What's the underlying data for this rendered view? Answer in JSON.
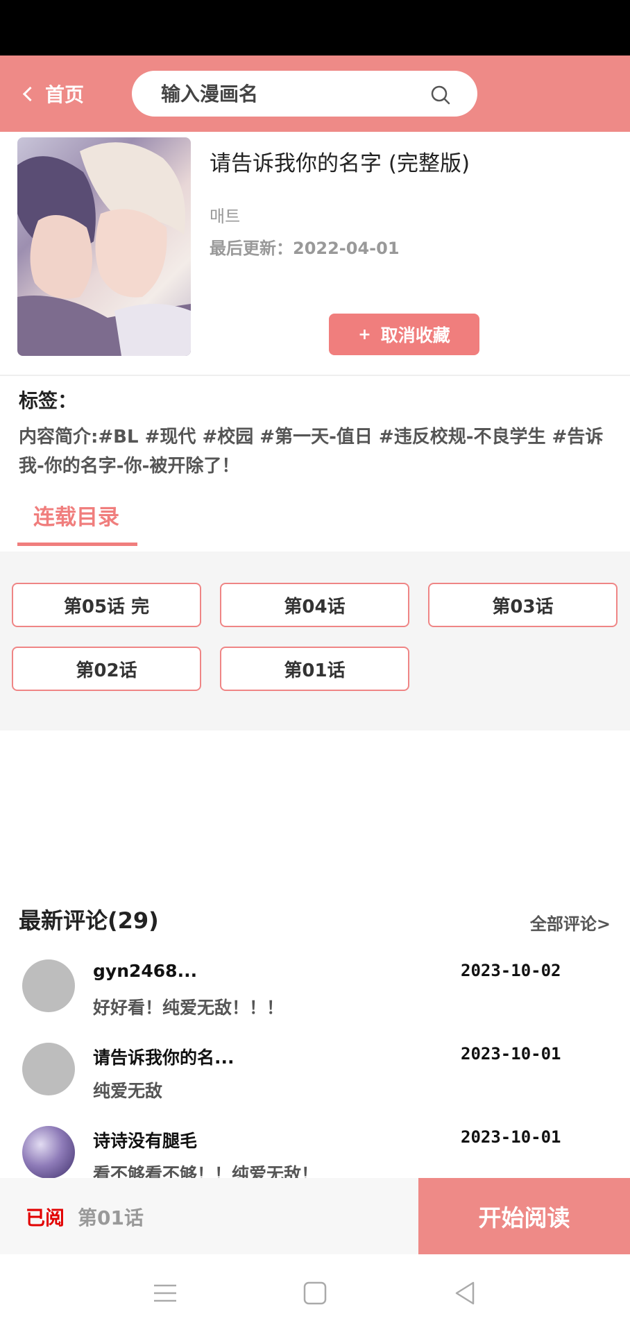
{
  "header": {
    "back_label": "首页",
    "search_placeholder": "输入漫画名"
  },
  "book": {
    "title": "请告诉我你的名字 (完整版)",
    "author": "매트",
    "updated": "最后更新：2022-04-01",
    "favorite_button": "取消收藏",
    "favorite_icon": "+"
  },
  "tags": {
    "label": "标签：",
    "summary": "内容简介:#BL #现代 #校园 #第一天-值日 #违反校规-不良学生 #告诉我-你的名字-你-被开除了！"
  },
  "tab": {
    "label": "连载目录"
  },
  "chapters": [
    "第05话 完",
    "第04话",
    "第03话",
    "第02话",
    "第01话"
  ],
  "comments": {
    "title": "最新评论(29)",
    "all_label": "全部评论>",
    "items": [
      {
        "user": "gyn2468...",
        "date": "2023-10-02",
        "text": "好好看！纯爱无敌！！！"
      },
      {
        "user": "请告诉我你的名...",
        "date": "2023-10-01",
        "text": "纯爱无敌"
      },
      {
        "user": "诗诗没有腿毛",
        "date": "2023-10-01",
        "text": "看不够看不够！！纯爱无敌！"
      }
    ]
  },
  "bottom_bar": {
    "read_label": "已阅",
    "read_chapter": "第01话",
    "start_button": "开始阅读"
  },
  "colors": {
    "accent": "#ee8a87",
    "button": "#f07e7d",
    "read_red": "#e20000"
  },
  "icons": {
    "back": "chevron-left-icon",
    "search": "search-icon",
    "nav_menu": "menu-icon",
    "nav_home": "home-square-icon",
    "nav_back": "back-triangle-icon"
  }
}
